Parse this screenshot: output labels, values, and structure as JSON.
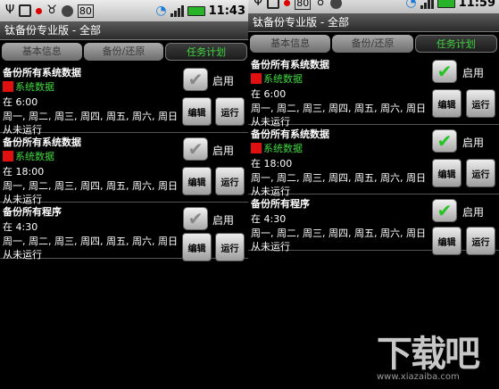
{
  "status": {
    "time_left": "11:43",
    "time_right": "11:59",
    "icons": [
      "usb-icon",
      "screen-icon",
      "red-dot-icon",
      "android-icon",
      "circle-icon",
      "battery-80-icon",
      "wifi-icon",
      "signal-icon",
      "battery-icon"
    ],
    "battery_level": "80"
  },
  "app": {
    "title": "钛备份专业版 - 全部",
    "tabs": [
      "基本信息",
      "备份/还原",
      "任务计划"
    ],
    "active_tab": 2,
    "accent": "#3fd83f"
  },
  "labels": {
    "enable": "启用",
    "edit": "编辑",
    "run": "运行"
  },
  "tasks": [
    {
      "name": "备份所有系统数据",
      "tag": "系统数据",
      "time": "在 6:00",
      "days": "周一, 周二, 周三, 周四, 周五, 周六, 周日",
      "status": "从未运行"
    },
    {
      "name": "备份所有系统数据",
      "tag": "系统数据",
      "time": "在 18:00",
      "days": "周一, 周二, 周三, 周四, 周五, 周六, 周日",
      "status": "从未运行"
    },
    {
      "name": "备份所有程序",
      "time": "在 4:30",
      "days": "周一, 周二, 周三, 周四, 周五, 周六, 周日",
      "status": "从未运行"
    }
  ],
  "screens": {
    "left": {
      "enabled": [
        false,
        false,
        false
      ]
    },
    "right": {
      "enabled": [
        true,
        true,
        true
      ]
    }
  },
  "watermark": {
    "logo": "下载吧",
    "url": "www.xiazaiba.com"
  }
}
